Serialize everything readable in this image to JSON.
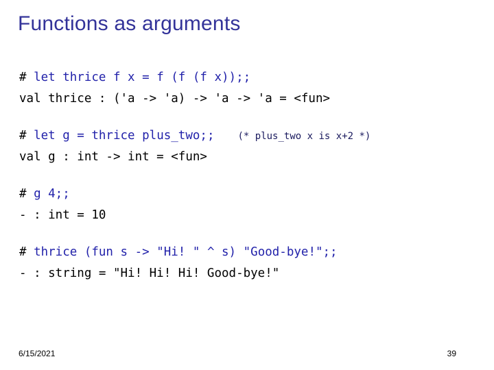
{
  "slide": {
    "title": "Functions as arguments",
    "title_color": "#333399",
    "input_color": "#2222aa",
    "output_color": "#000000",
    "background_color": "#ffffff"
  },
  "code": {
    "blocks": [
      {
        "prompt": "# ",
        "input": "let thrice f x = f (f (f x));;",
        "comment": "",
        "output": "val thrice : ('a -> 'a) -> 'a -> 'a = <fun>"
      },
      {
        "prompt": "# ",
        "input": "let g = thrice plus_two;;",
        "comment": "(* plus_two x is x+2 *)",
        "output": "val g : int -> int = <fun>"
      },
      {
        "prompt": "# ",
        "input": "g 4;;",
        "comment": "",
        "output": "- : int = 10"
      },
      {
        "prompt": "# ",
        "input": "thrice (fun s -> \"Hi! \" ^ s) \"Good-bye!\";;",
        "comment": "",
        "output": "- : string = \"Hi! Hi! Hi! Good-bye!\""
      }
    ]
  },
  "footer": {
    "date": "6/15/2021",
    "page_number": "39"
  }
}
